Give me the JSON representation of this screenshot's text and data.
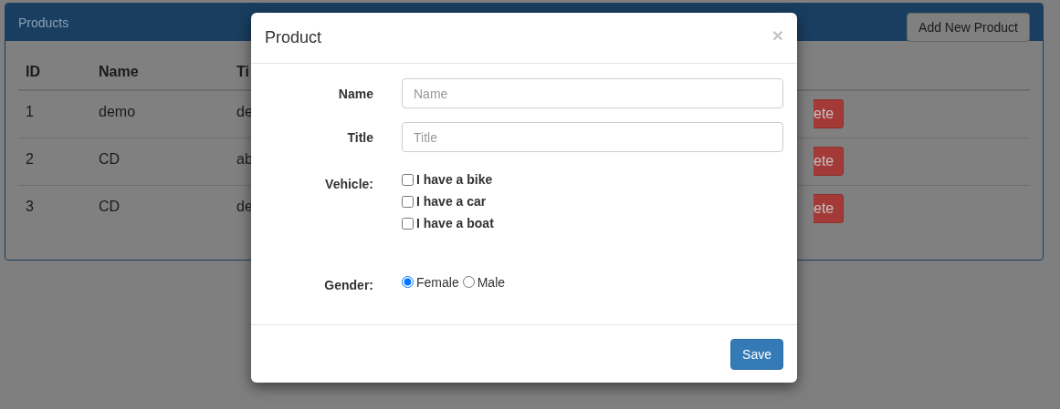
{
  "panel": {
    "title": "Products",
    "add_button": "Add New Product"
  },
  "table": {
    "columns": [
      "ID",
      "Name",
      "Ti"
    ],
    "rows": [
      {
        "cells": [
          "1",
          "demo",
          "de"
        ],
        "action": "ete"
      },
      {
        "cells": [
          "2",
          "CD",
          "ab"
        ],
        "action": "ete"
      },
      {
        "cells": [
          "3",
          "CD",
          "de"
        ],
        "action": "ete"
      }
    ]
  },
  "modal": {
    "title": "Product",
    "close": "×",
    "fields": [
      {
        "label": "Name",
        "placeholder": "Name"
      },
      {
        "label": "Title",
        "placeholder": "Title"
      }
    ],
    "vehicle": {
      "label": "Vehicle:",
      "options": [
        {
          "label": "I have a bike",
          "checked": false
        },
        {
          "label": "I have a car",
          "checked": false
        },
        {
          "label": "I have a boat",
          "checked": false
        }
      ]
    },
    "gender": {
      "label": "Gender:",
      "options": [
        {
          "label": "Female",
          "selected": true
        },
        {
          "label": "Male",
          "selected": false
        }
      ]
    },
    "save": "Save"
  }
}
